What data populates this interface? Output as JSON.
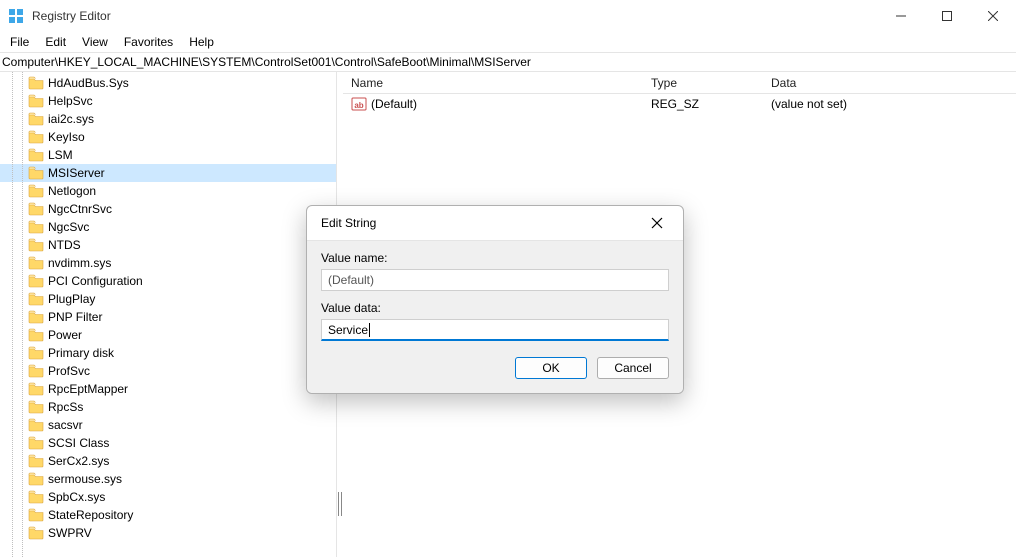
{
  "window": {
    "title": "Registry Editor"
  },
  "menu": {
    "file": "File",
    "edit": "Edit",
    "view": "View",
    "favorites": "Favorites",
    "help": "Help"
  },
  "address": "Computer\\HKEY_LOCAL_MACHINE\\SYSTEM\\ControlSet001\\Control\\SafeBoot\\Minimal\\MSIServer",
  "tree": {
    "items": [
      {
        "label": "HdAudBus.Sys"
      },
      {
        "label": "HelpSvc"
      },
      {
        "label": "iai2c.sys"
      },
      {
        "label": "KeyIso"
      },
      {
        "label": "LSM"
      },
      {
        "label": "MSIServer",
        "selected": true
      },
      {
        "label": "Netlogon"
      },
      {
        "label": "NgcCtnrSvc"
      },
      {
        "label": "NgcSvc"
      },
      {
        "label": "NTDS"
      },
      {
        "label": "nvdimm.sys"
      },
      {
        "label": "PCI Configuration"
      },
      {
        "label": "PlugPlay"
      },
      {
        "label": "PNP Filter"
      },
      {
        "label": "Power"
      },
      {
        "label": "Primary disk"
      },
      {
        "label": "ProfSvc"
      },
      {
        "label": "RpcEptMapper"
      },
      {
        "label": "RpcSs"
      },
      {
        "label": "sacsvr"
      },
      {
        "label": "SCSI Class"
      },
      {
        "label": "SerCx2.sys"
      },
      {
        "label": "sermouse.sys"
      },
      {
        "label": "SpbCx.sys"
      },
      {
        "label": "StateRepository"
      },
      {
        "label": "SWPRV"
      }
    ]
  },
  "list": {
    "headers": {
      "name": "Name",
      "type": "Type",
      "data": "Data"
    },
    "rows": [
      {
        "name": "(Default)",
        "type": "REG_SZ",
        "data": "(value not set)"
      }
    ]
  },
  "dialog": {
    "title": "Edit String",
    "value_name_label": "Value name:",
    "value_name": "(Default)",
    "value_data_label": "Value data:",
    "value_data": "Service",
    "ok": "OK",
    "cancel": "Cancel"
  }
}
